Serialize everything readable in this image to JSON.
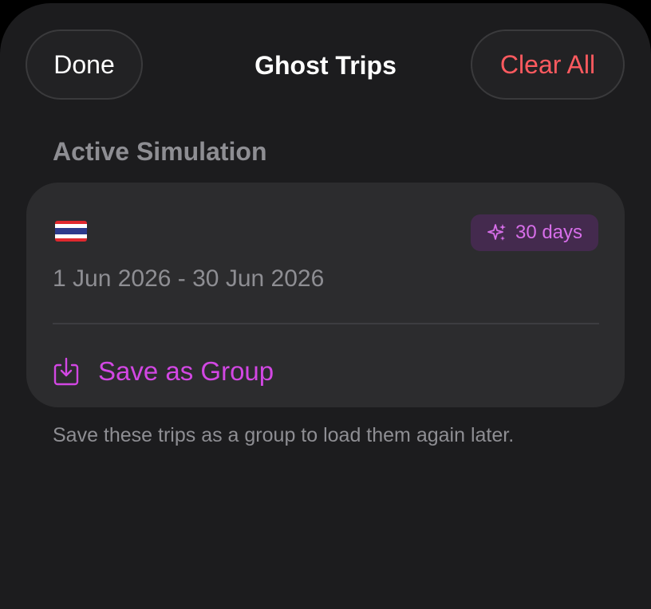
{
  "header": {
    "title": "Ghost Trips",
    "done_label": "Done",
    "clear_all_label": "Clear All"
  },
  "section": {
    "title": "Active Simulation"
  },
  "trip_card": {
    "flag_icon": "thailand-flag",
    "badge": {
      "icon": "sparkles-icon",
      "label": "30 days"
    },
    "date_range": "1 Jun 2026 - 30 Jun 2026",
    "save_action": {
      "icon": "save-download-icon",
      "label": "Save as Group"
    }
  },
  "footer_note": "Save these trips as a group to load them again later.",
  "colors": {
    "background": "#1c1c1e",
    "card": "#2c2c2e",
    "accent_purple": "#d247e3",
    "destructive_red": "#ff5a5f",
    "secondary_text": "#8e8e93"
  }
}
